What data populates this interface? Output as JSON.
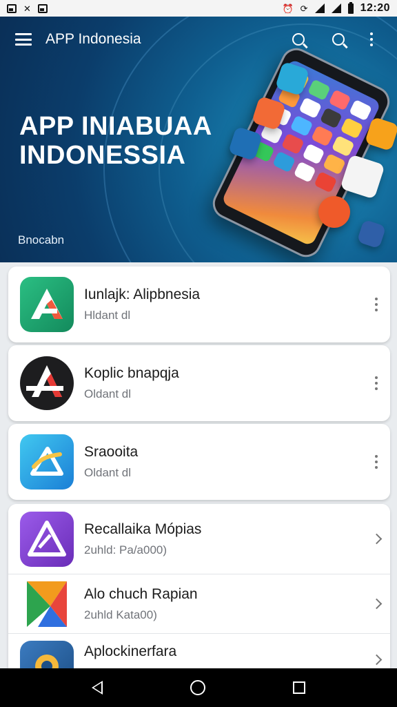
{
  "status_bar": {
    "time": "12:20",
    "left_icons": [
      "gallery-notification-icon",
      "tools-notification-icon",
      "music-notification-icon"
    ],
    "right_icons": [
      "alarm-icon",
      "sync-icon",
      "wifi-icon",
      "signal-icon",
      "battery-icon"
    ]
  },
  "app_bar": {
    "title": "APP Indonesia",
    "actions": [
      "search-icon",
      "search-icon",
      "overflow-menu-icon"
    ]
  },
  "hero": {
    "title_line1": "APP INIABUAA",
    "title_line2": "INDONESSIA",
    "caption": "Bnocabn",
    "colors": {
      "dark": "#0a2f57",
      "light": "#1d8fbd"
    }
  },
  "apps": [
    {
      "title": "Iunlajk: Alipbnesia",
      "subtitle": "Hldant dl",
      "trailing": "overflow-menu-icon",
      "icon_color": "#1fa673"
    },
    {
      "title": "Koplic bnapqja",
      "subtitle": "Oldant dl",
      "trailing": "overflow-menu-icon",
      "icon_color": "#1d1d1f"
    },
    {
      "title": "Sraooita",
      "subtitle": "Oldant dl",
      "trailing": "overflow-menu-icon",
      "icon_color": "#2aa6e0"
    },
    {
      "title": "Recallaikа Mópias",
      "subtitle": "2uhld: Pa/a000)",
      "trailing": "chevron-right-icon",
      "icon_color": "#7b3fc4"
    },
    {
      "title": "Alo chuch Rapian",
      "subtitle": "2uhld Kata00)",
      "trailing": "chevron-right-icon",
      "icon_color": "#f29b1d"
    },
    {
      "title": "Aplockinerfara",
      "subtitle": "",
      "trailing": "chevron-right-icon",
      "icon_color": "#2d6fa8"
    }
  ],
  "nav_bar": {
    "buttons": [
      "back-icon",
      "home-icon",
      "recent-apps-icon"
    ]
  }
}
